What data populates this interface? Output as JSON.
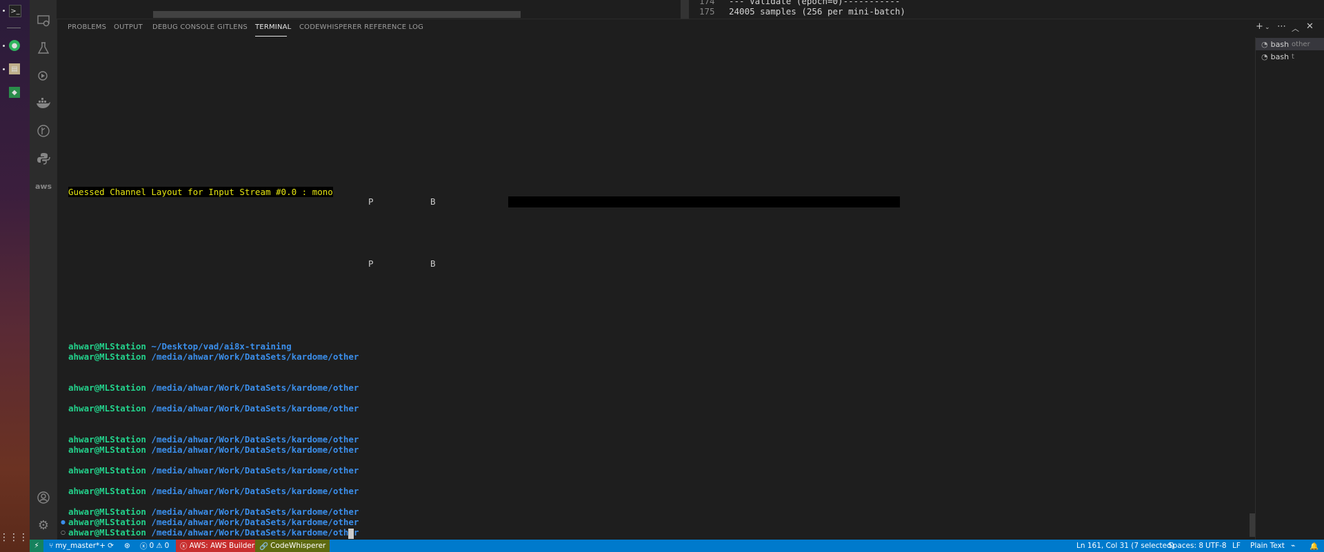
{
  "editor": {
    "lines": [
      {
        "num": "174",
        "text": "--- Validate (epoch=0)-----------"
      },
      {
        "num": "175",
        "text": "24005 samples (256 per mini-batch)"
      }
    ]
  },
  "panel": {
    "tabs": [
      "PROBLEMS",
      "OUTPUT",
      "DEBUG CONSOLE",
      "GITLENS",
      "TERMINAL",
      "CODEWHISPERER REFERENCE LOG"
    ],
    "active_tab": "TERMINAL"
  },
  "terminal": {
    "warning": "Guessed Channel Layout for Input Stream #0.0 : mono",
    "progress_letters": [
      "P",
      "B",
      "P",
      "B"
    ],
    "prompt_user": "ahwar@MLStation",
    "prompts": [
      "~/Desktop/vad/ai8x-training",
      "/media/ahwar/Work/DataSets/kardome/other",
      "/media/ahwar/Work/DataSets/kardome/other",
      "/media/ahwar/Work/DataSets/kardome/other",
      "/media/ahwar/Work/DataSets/kardome/other",
      "/media/ahwar/Work/DataSets/kardome/other",
      "/media/ahwar/Work/DataSets/kardome/other",
      "/media/ahwar/Work/DataSets/kardome/other",
      "/media/ahwar/Work/DataSets/kardome/other",
      "/media/ahwar/Work/DataSets/kardome/other",
      "/media/ahwar/Work/DataSets/kardome/other"
    ]
  },
  "terminal_list": [
    {
      "name": "bash",
      "detail": "other"
    },
    {
      "name": "bash",
      "detail": "t"
    }
  ],
  "status": {
    "branch": "my_master*+",
    "errors": "0",
    "warnings": "0",
    "aws": "AWS: AWS Builder ID",
    "codewhisperer": "CodeWhisperer",
    "position": "Ln 161, Col 31 (7 selected)",
    "spaces": "Spaces: 8",
    "encoding": "UTF-8",
    "eol": "LF",
    "language": "Plain Text"
  },
  "colors": {
    "status_bar": "#007acc",
    "prompt_user": "#23d18b",
    "prompt_path": "#3b8eea",
    "warning_text": "#e5e510"
  },
  "icons": {
    "activity": [
      "remote-explorer-icon",
      "testing-beaker-icon",
      "run-debug-icon",
      "docker-icon",
      "git-graph-icon",
      "python-icon",
      "aws-icon",
      "account-icon",
      "settings-gear-icon"
    ]
  }
}
